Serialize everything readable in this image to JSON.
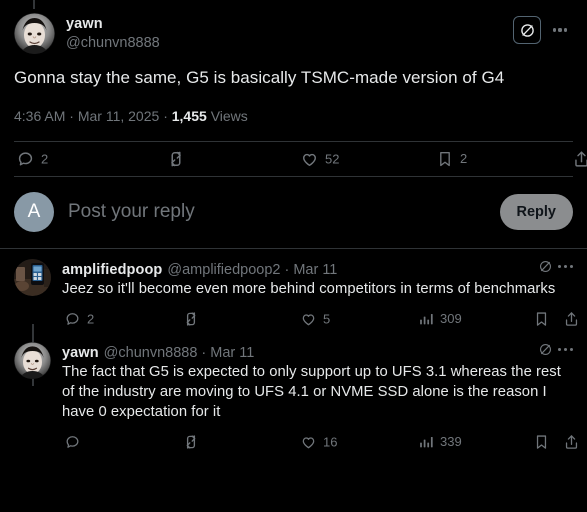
{
  "theme": {
    "background": "#000000",
    "text_primary": "#e7e9ea",
    "text_secondary": "#71767b",
    "divider": "#2f3336",
    "reply_button_bg": "#8b8d8f",
    "composer_avatar_bg": "#8899a6"
  },
  "main_tweet": {
    "display_name": "yawn",
    "handle": "@chunvn8888",
    "avatar_alt": "yawn-avatar",
    "text": "Gonna stay the same, G5 is basically TSMC-made version of G4",
    "timestamp": "4:36 AM",
    "meta_sep": "·",
    "date": "Mar 11, 2025",
    "views_count": "1,455",
    "views_label": "Views",
    "grok_icon": "grok-icon",
    "more_icon": "more-options-icon",
    "actions": {
      "reply": {
        "icon": "reply-icon",
        "count": "2"
      },
      "repost": {
        "icon": "repost-icon",
        "count": ""
      },
      "like": {
        "icon": "like-icon",
        "count": "52"
      },
      "bookmark": {
        "icon": "bookmark-icon",
        "count": "2"
      },
      "share": {
        "icon": "share-icon",
        "count": ""
      }
    }
  },
  "composer": {
    "avatar_initial": "A",
    "placeholder": "Post your reply",
    "reply_label": "Reply"
  },
  "replies": [
    {
      "display_name": "amplifiedpoop",
      "handle": "@amplifiedpoop2",
      "separator": "·",
      "date": "Mar 11",
      "avatar_alt": "amplifiedpoop-avatar",
      "text": "Jeez so it'll become even more behind competitors in terms of benchmarks",
      "grok_icon": "grok-icon",
      "more_icon": "more-options-icon",
      "actions": {
        "reply": {
          "icon": "reply-icon",
          "count": "2"
        },
        "repost": {
          "icon": "repost-icon",
          "count": ""
        },
        "like": {
          "icon": "like-icon",
          "count": "5"
        },
        "views": {
          "icon": "views-icon",
          "count": "309"
        },
        "bookmark": {
          "icon": "bookmark-icon",
          "count": ""
        },
        "share": {
          "icon": "share-icon",
          "count": ""
        }
      }
    },
    {
      "display_name": "yawn",
      "handle": "@chunvn8888",
      "separator": "·",
      "date": "Mar 11",
      "avatar_alt": "yawn-avatar",
      "text": "The fact that G5 is expected to only support up to UFS 3.1 whereas the rest of the industry are moving to UFS 4.1 or NVME SSD alone is the reason I have 0 expectation for it",
      "grok_icon": "grok-icon",
      "more_icon": "more-options-icon",
      "actions": {
        "reply": {
          "icon": "reply-icon",
          "count": ""
        },
        "repost": {
          "icon": "repost-icon",
          "count": ""
        },
        "like": {
          "icon": "like-icon",
          "count": "16"
        },
        "views": {
          "icon": "views-icon",
          "count": "339"
        },
        "bookmark": {
          "icon": "bookmark-icon",
          "count": ""
        },
        "share": {
          "icon": "share-icon",
          "count": ""
        }
      }
    }
  ]
}
